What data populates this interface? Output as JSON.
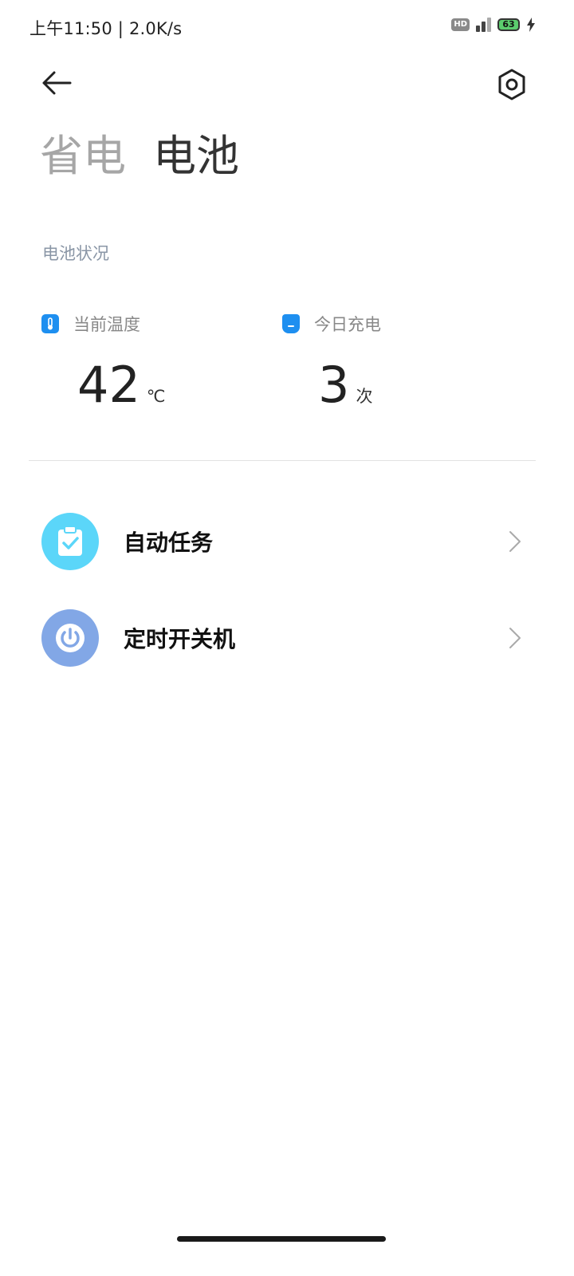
{
  "status_bar": {
    "time": "上午11:50 | 2.0K/s",
    "hd_label": "HD",
    "battery_level": "63"
  },
  "header": {
    "tabs": [
      {
        "label": "省电",
        "active": false
      },
      {
        "label": "电池",
        "active": true
      }
    ]
  },
  "battery_status": {
    "section_title": "电池状况",
    "temperature": {
      "label": "当前温度",
      "value": "42",
      "unit": "℃"
    },
    "charging_today": {
      "label": "今日充电",
      "value": "3",
      "unit": "次"
    }
  },
  "list": [
    {
      "label": "自动任务",
      "icon": "clipboard-check-icon",
      "color": "#5bd6f9"
    },
    {
      "label": "定时开关机",
      "icon": "power-icon",
      "color": "#82a7e6"
    }
  ]
}
